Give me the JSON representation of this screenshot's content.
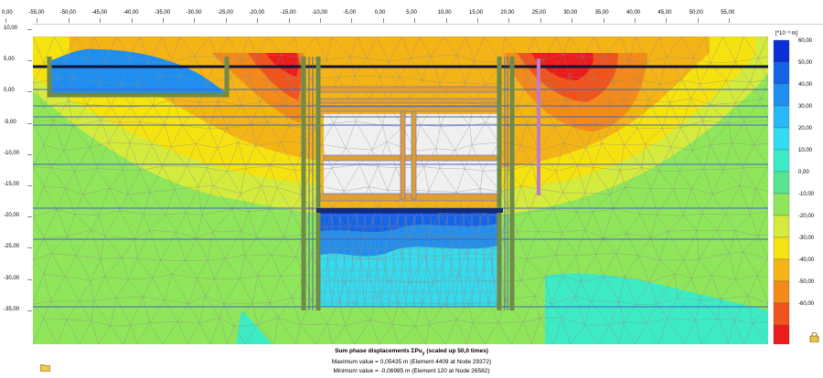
{
  "x_axis": {
    "ticks": [
      "0,00",
      "-55,00",
      "-50,00",
      "-45,00",
      "-40,00",
      "-35,00",
      "-30,00",
      "-25,00",
      "-20,00",
      "-15,00",
      "-10,00",
      "-5,00",
      "0,00",
      "5,00",
      "10,00",
      "15,00",
      "20,00",
      "25,00",
      "30,00",
      "35,00",
      "40,00",
      "45,00",
      "50,00",
      "55,00"
    ],
    "first_tick_partial": true
  },
  "y_axis": {
    "ticks": [
      "10,00",
      "5,00",
      "0,00",
      "-5,00",
      "-10,00",
      "-15,00",
      "-20,00",
      "-25,00",
      "-30,00",
      "-35,00"
    ]
  },
  "legend": {
    "unit": "[*10⁻³ m]",
    "ticks": [
      "60,00",
      "50,00",
      "40,00",
      "30,00",
      "20,00",
      "10,00",
      "0,00",
      "-10,00",
      "-20,00",
      "-30,00",
      "-40,00",
      "-50,00",
      "-60,00",
      "-70,00"
    ],
    "colors": [
      "#0a2fd6",
      "#1463e6",
      "#1e8ff0",
      "#28b8f5",
      "#34dcf0",
      "#3cebc4",
      "#55e68f",
      "#8fe65a",
      "#d4ea3c",
      "#f6e20f",
      "#f5b415",
      "#f38a19",
      "#f0541c",
      "#ea1c1c"
    ]
  },
  "plot_colors": {
    "mesh": "#8a8a8a",
    "soil_layer": "#4460c8",
    "wall": "#6f8a4a",
    "strut": "#e0a030",
    "excavation": "#f0f0f0"
  },
  "caption": {
    "title": "Sum phase displacements ΣPu",
    "title_sub": "y",
    "title_suffix": " (scaled up 50,0 times)",
    "max_line": "Maximum value = 0,05435 m (Element 4409 at Node 29372)",
    "min_line": "Minimum value = -0,06985 m (Element 120 at Node 26582)"
  },
  "icons": {
    "lock": "lock-icon",
    "folder": "folder-icon"
  }
}
